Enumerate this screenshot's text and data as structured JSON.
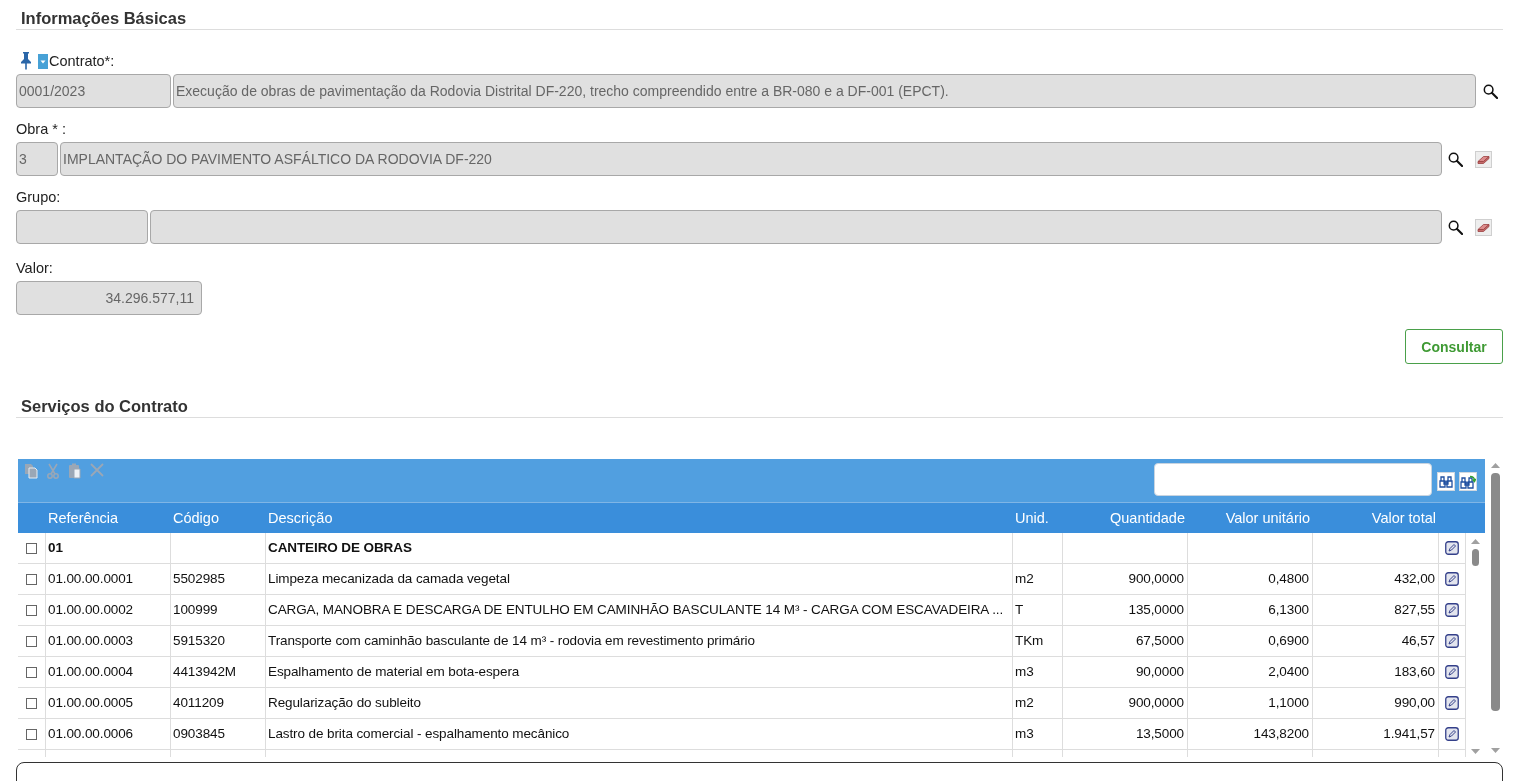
{
  "basic_info": {
    "title": "Informações Básicas",
    "lookups": [
      {
        "label": "Contrato*:",
        "pinned": true,
        "code": "0001/2023",
        "description": "Execução de obras de pavimentação da Rodovia Distrital DF-220, trecho compreendido entre a BR-080 e a DF-001 (EPCT).",
        "clearable": false
      },
      {
        "label": "Obra * :",
        "pinned": false,
        "code": "3",
        "description": "IMPLANTAÇÃO DO PAVIMENTO ASFÁLTICO DA RODOVIA DF-220",
        "clearable": true
      },
      {
        "label": "Grupo:",
        "pinned": false,
        "clearable": true
      }
    ],
    "value_field": {
      "label": "Valor:",
      "value": "34.296.577,11"
    },
    "submit_button": "Consultar"
  },
  "services": {
    "title": "Serviços do Contrato",
    "toolbar": {
      "disabled": true
    },
    "columns": [
      "Referência",
      "Código",
      "Descrição",
      "Unid.",
      "Quantidade",
      "Valor unitário",
      "Valor total"
    ],
    "rows": [
      {
        "kind": "group",
        "checked": false,
        "reference": "01",
        "description": "CANTEIRO DE OBRAS"
      },
      {
        "kind": "item",
        "checked": false,
        "reference": "01.00.00.0001",
        "code": "5502985",
        "description": "Limpeza mecanizada da camada vegetal",
        "unit": "m2",
        "quantity": "900,0000",
        "unit_value": "0,4800",
        "total": "432,00"
      },
      {
        "kind": "item",
        "checked": false,
        "reference": "01.00.00.0002",
        "code": "100999",
        "description": "CARGA, MANOBRA E DESCARGA DE ENTULHO EM CAMINHÃO BASCULANTE 14 M³ - CARGA COM ESCAVADEIRA ...",
        "unit": "T",
        "quantity": "135,0000",
        "unit_value": "6,1300",
        "total": "827,55"
      },
      {
        "kind": "item",
        "checked": false,
        "reference": "01.00.00.0003",
        "code": "5915320",
        "description": "Transporte com caminhão basculante de 14 m³ - rodovia em revestimento primário",
        "unit": "TKm",
        "quantity": "67,5000",
        "unit_value": "0,6900",
        "total": "46,57"
      },
      {
        "kind": "item",
        "checked": false,
        "reference": "01.00.00.0004",
        "code": "4413942M",
        "description": "Espalhamento de material em bota-espera",
        "unit": "m3",
        "quantity": "90,0000",
        "unit_value": "2,0400",
        "total": "183,60"
      },
      {
        "kind": "item",
        "checked": false,
        "reference": "01.00.00.0005",
        "code": "4011209",
        "description": "Regularização do subleito",
        "unit": "m2",
        "quantity": "900,0000",
        "unit_value": "1,1000",
        "total": "990,00"
      },
      {
        "kind": "item",
        "checked": false,
        "reference": "01.00.00.0006",
        "code": "0903845",
        "description": "Lastro de brita comercial - espalhamento mecânico",
        "unit": "m3",
        "quantity": "13,5000",
        "unit_value": "143,8200",
        "total": "1.941,57"
      }
    ]
  }
}
